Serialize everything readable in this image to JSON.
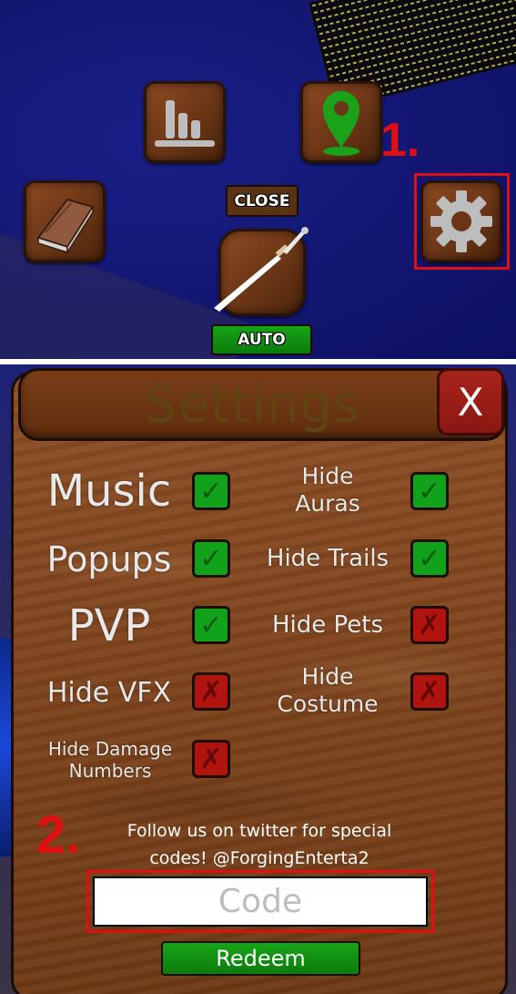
{
  "top_menu": {
    "close_label": "CLOSE",
    "auto_label": "AUTO",
    "step_annotation": "1."
  },
  "settings": {
    "title": "Settings",
    "close_x": "X",
    "options": [
      {
        "label": "Music",
        "enabled": true
      },
      {
        "label_line1": "Hide",
        "label_line2": "Auras",
        "enabled": true
      },
      {
        "label": "Popups",
        "enabled": true
      },
      {
        "label": "Hide Trails",
        "enabled": true
      },
      {
        "label": "PVP",
        "enabled": true
      },
      {
        "label": "Hide Pets",
        "enabled": false
      },
      {
        "label": "Hide VFX",
        "enabled": false
      },
      {
        "label_line1": "Hide",
        "label_line2": "Costume",
        "enabled": false
      },
      {
        "label_line1": "Hide Damage",
        "label_line2": "Numbers",
        "enabled": false
      }
    ],
    "checkbox_on": "✓",
    "checkbox_off": "✗",
    "follow_line1": "Follow us on twitter for special",
    "follow_line2": "codes! @ForgingEnterta2",
    "step_annotation": "2.",
    "code_placeholder": "Code",
    "redeem_label": "Redeem"
  },
  "colors": {
    "annotation_red": "#e01010",
    "checkbox_on": "#11a11a",
    "checkbox_off": "#b1130f",
    "wood": "#7d431c"
  }
}
